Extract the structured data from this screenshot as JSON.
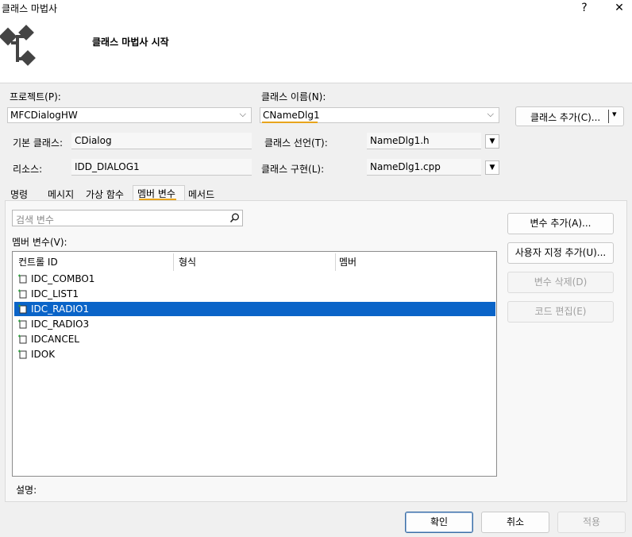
{
  "window": {
    "title": "클래스 마법사",
    "help_label": "?",
    "close_label": "✕",
    "header_title": "클래스 마법사 시작"
  },
  "project": {
    "label": "프로젝트(P):",
    "value": "MFCDialogHW"
  },
  "class_name": {
    "label": "클래스 이름(N):",
    "value": "CNameDlg1"
  },
  "add_class_button": {
    "label": "클래스 추가(C)...",
    "arrow": "▾"
  },
  "base_class": {
    "label": "기본 클래스:",
    "value": "CDialog"
  },
  "resource": {
    "label": "리소스:",
    "value": "IDD_DIALOG1"
  },
  "class_declaration": {
    "label": "클래스 선언(T):",
    "value": "NameDlg1.h"
  },
  "class_implementation": {
    "label": "클래스 구현(L):",
    "value": "NameDlg1.cpp"
  },
  "tabs": [
    {
      "label": "명령"
    },
    {
      "label": "메시지"
    },
    {
      "label": "가상 함수"
    },
    {
      "label": "멤버 변수"
    },
    {
      "label": "메서드"
    }
  ],
  "search": {
    "placeholder": "검색 변수"
  },
  "member_vars_label": "멤버 변수(V):",
  "list": {
    "columns": [
      "컨트롤 ID",
      "형식",
      "멤버"
    ],
    "rows": [
      {
        "id": "IDC_COMBO1",
        "type": "",
        "member": ""
      },
      {
        "id": "IDC_LIST1",
        "type": "",
        "member": ""
      },
      {
        "id": "IDC_RADIO1",
        "type": "",
        "member": "",
        "selected": true
      },
      {
        "id": "IDC_RADIO3",
        "type": "",
        "member": ""
      },
      {
        "id": "IDCANCEL",
        "type": "",
        "member": ""
      },
      {
        "id": "IDOK",
        "type": "",
        "member": ""
      }
    ]
  },
  "side_buttons": {
    "add_variable": "변수 추가(A)...",
    "add_custom": "사용자 지정 추가(U)...",
    "delete_variable": "변수 삭제(D)",
    "edit_code": "코드 편집(E)"
  },
  "description_label": "설명:",
  "footer": {
    "ok": "확인",
    "cancel": "취소",
    "apply": "적용"
  },
  "colors": {
    "selection": "#0a64c8",
    "accent_underline": "#e8a41c"
  }
}
